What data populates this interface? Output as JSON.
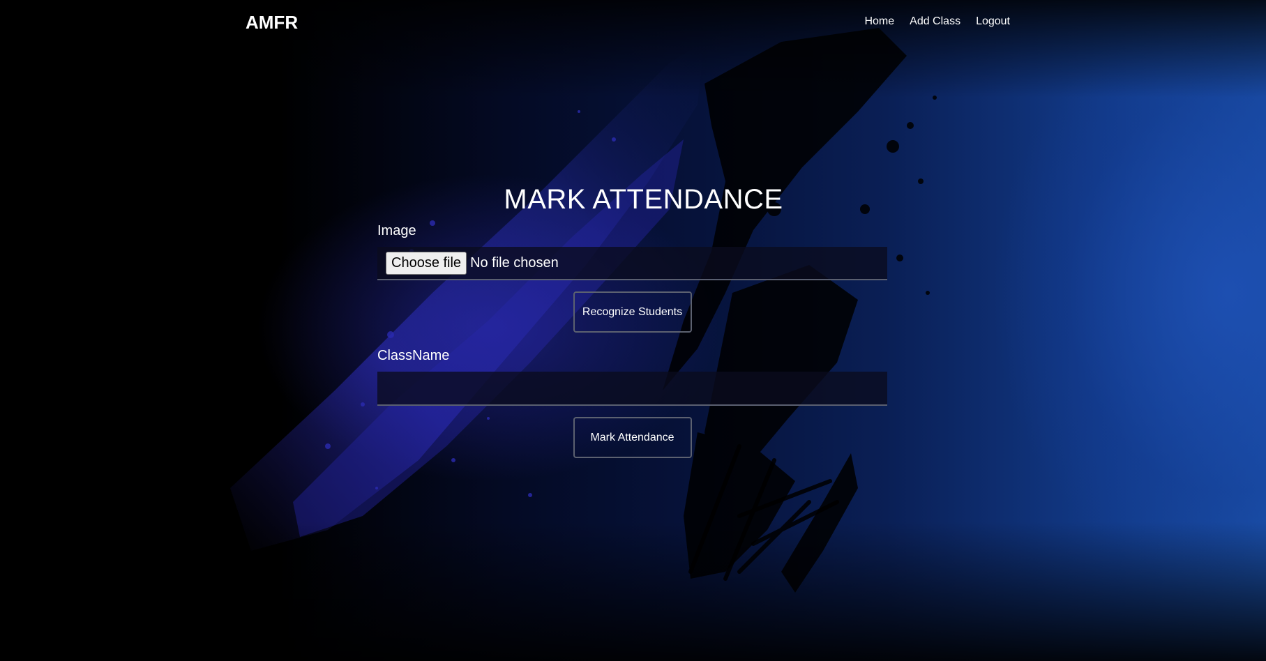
{
  "navbar": {
    "brand": "AMFR",
    "links": [
      {
        "label": "Home"
      },
      {
        "label": "Add Class"
      },
      {
        "label": "Logout"
      }
    ]
  },
  "form": {
    "title": "MARK ATTENDANCE",
    "image_label": "Image",
    "file_button_label": "Choose file",
    "file_status": "No file chosen",
    "recognize_button_label": "Recognize Students",
    "classname_label": "ClassName",
    "classname_value": "",
    "mark_button_label": "Mark Attendance"
  },
  "colors": {
    "background": "#02040a",
    "accent_blue": "#1a4fa8",
    "splatter": "#2a2aa8",
    "button_border": "#5c6170",
    "text": "#ffffff"
  }
}
